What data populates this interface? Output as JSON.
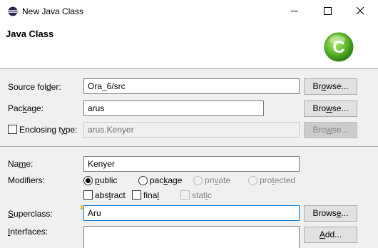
{
  "window": {
    "title": "New Java Class",
    "controls": {
      "minimize_icon": "minimize-icon",
      "maximize_icon": "maximize-icon",
      "close_icon": "close-icon"
    }
  },
  "banner": {
    "heading": "Java Class",
    "logo_letter": "C",
    "logo_color": "#5cb82e"
  },
  "source_folder": {
    "label_pre": "Source fol",
    "label_u": "d",
    "label_post": "er:",
    "value": "Ora_6/src",
    "button": {
      "pre": "Br",
      "u": "o",
      "post": "wse..."
    }
  },
  "package": {
    "label_pre": "Pac",
    "label_u": "k",
    "label_post": "age:",
    "value": "arus",
    "button": {
      "pre": "Bro",
      "u": "w",
      "post": "se..."
    }
  },
  "enclosing_type": {
    "label_pre": "Enclosing t",
    "label_u": "y",
    "label_post": "pe:",
    "checked": false,
    "value": "arus.Kenyer",
    "button": {
      "pre": "Bro",
      "u": "w",
      "post": "se..."
    }
  },
  "name": {
    "label_pre": "Na",
    "label_u": "m",
    "label_post": "e:",
    "value": "Kenyer"
  },
  "modifiers": {
    "label": "Modifiers:",
    "access": [
      {
        "pre": "",
        "u": "p",
        "post": "ublic",
        "checked": true,
        "enabled": true
      },
      {
        "pre": "pac",
        "u": "k",
        "post": "age",
        "checked": false,
        "enabled": true
      },
      {
        "pre": "pri",
        "u": "v",
        "post": "ate",
        "checked": false,
        "enabled": false
      },
      {
        "pre": "pro",
        "u": "t",
        "post": "ected",
        "checked": false,
        "enabled": false
      }
    ],
    "other": [
      {
        "pre": "abs",
        "u": "t",
        "post": "ract",
        "checked": false,
        "enabled": true
      },
      {
        "pre": "fina",
        "u": "l",
        "post": "",
        "checked": false,
        "enabled": true
      },
      {
        "pre": "stat",
        "u": "i",
        "post": "c",
        "checked": false,
        "enabled": false
      }
    ]
  },
  "superclass": {
    "label_pre": "",
    "label_u": "S",
    "label_post": "uperclass:",
    "value": "Aru",
    "button": {
      "pre": "Brows",
      "u": "e",
      "post": "..."
    }
  },
  "interfaces": {
    "label_pre": "",
    "label_u": "I",
    "label_post": "nterfaces:",
    "button": {
      "pre": "",
      "u": "A",
      "post": "dd..."
    }
  }
}
